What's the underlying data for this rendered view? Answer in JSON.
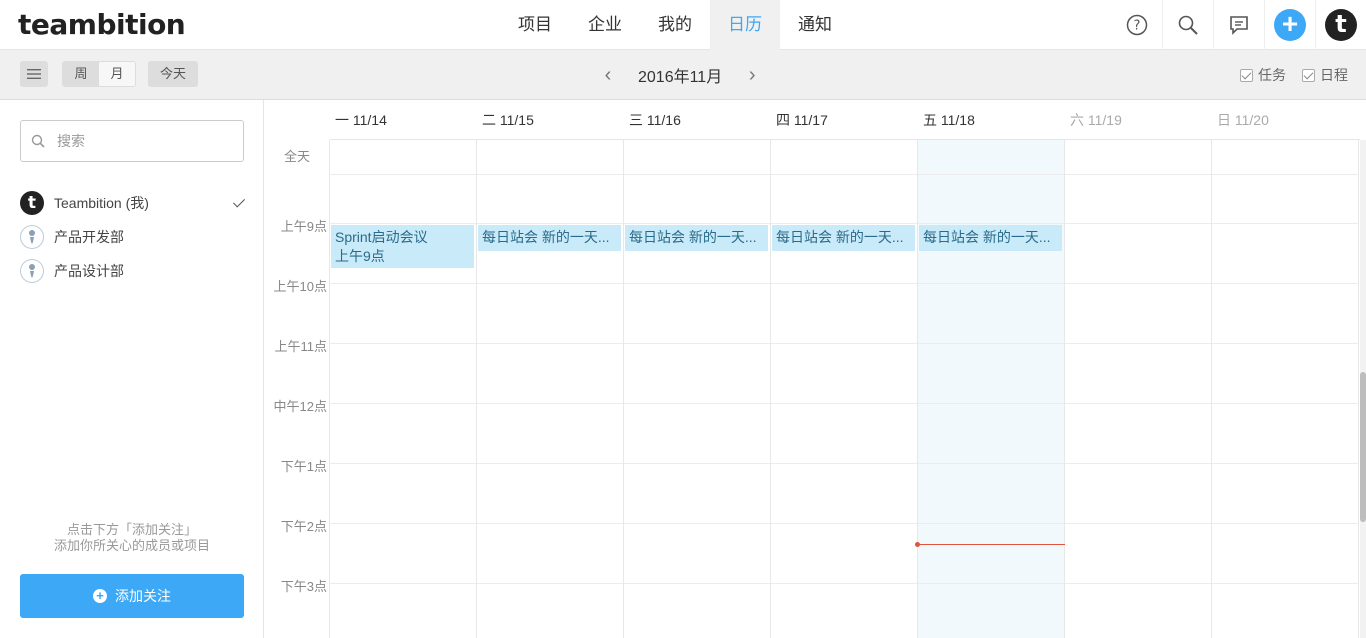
{
  "app": {
    "logo": "teambition"
  },
  "nav": {
    "items": [
      "项目",
      "企业",
      "我的",
      "日历",
      "通知"
    ],
    "active": "日历"
  },
  "top_icons": [
    "help-icon",
    "search-icon",
    "chat-icon",
    "plus-icon",
    "user-avatar"
  ],
  "avatar_letter": "t",
  "toolbar": {
    "view_week": "周",
    "view_month": "月",
    "today": "今天",
    "month_title": "2016年11月",
    "prev": "‹",
    "next": "›",
    "filter_task": "任务",
    "filter_schedule": "日程"
  },
  "sidebar": {
    "search_placeholder": "搜索",
    "items": [
      {
        "label": "Teambition (我)",
        "checked": true
      },
      {
        "label": "产品开发部",
        "checked": false
      },
      {
        "label": "产品设计部",
        "checked": false
      }
    ],
    "hint_line1": "点击下方「添加关注」",
    "hint_line2": "添加你所关心的成员或项目",
    "add_follow": "添加关注"
  },
  "calendar": {
    "allday_label": "全天",
    "days": [
      {
        "label": "一 11/14",
        "weekend": false
      },
      {
        "label": "二 11/15",
        "weekend": false
      },
      {
        "label": "三 11/16",
        "weekend": false
      },
      {
        "label": "四 11/17",
        "weekend": false
      },
      {
        "label": "五 11/18",
        "weekend": false,
        "today": true
      },
      {
        "label": "六 11/19",
        "weekend": true
      },
      {
        "label": "日 11/20",
        "weekend": true
      }
    ],
    "hours": [
      "上午9点",
      "上午10点",
      "上午11点",
      "中午12点",
      "下午1点",
      "下午2点",
      "下午3点"
    ],
    "events": [
      {
        "title": "Sprint启动会议",
        "time": "上午9点"
      },
      {
        "title": "每日站会 新的一天..."
      },
      {
        "title": "每日站会 新的一天..."
      },
      {
        "title": "每日站会 新的一天..."
      },
      {
        "title": "每日站会 新的一天..."
      }
    ]
  },
  "colors": {
    "accent": "#3da8f5",
    "event_bg": "#c9eaf8",
    "now_line": "#e0533f"
  }
}
